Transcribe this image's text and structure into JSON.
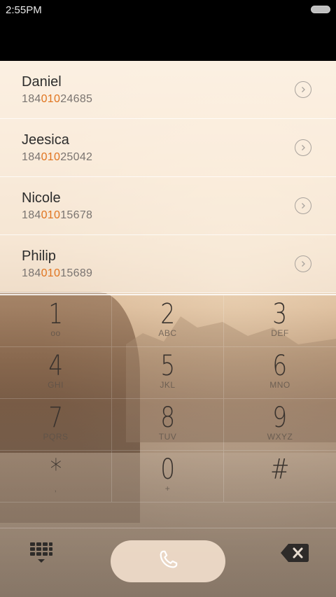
{
  "status_bar": {
    "time": "2:55PM"
  },
  "contacts": [
    {
      "name": "Daniel",
      "number_pre": "184",
      "number_match": "010",
      "number_post": "24685"
    },
    {
      "name": "Jeesica",
      "number_pre": "184",
      "number_match": "010",
      "number_post": "25042"
    },
    {
      "name": "Nicole",
      "number_pre": "184",
      "number_match": "010",
      "number_post": "15678"
    },
    {
      "name": "Philip",
      "number_pre": "184",
      "number_match": "010",
      "number_post": "15689"
    }
  ],
  "keypad": [
    {
      "digit": "1",
      "letters": "oo"
    },
    {
      "digit": "2",
      "letters": "ABC"
    },
    {
      "digit": "3",
      "letters": "DEF"
    },
    {
      "digit": "4",
      "letters": "GHI"
    },
    {
      "digit": "5",
      "letters": "JKL"
    },
    {
      "digit": "6",
      "letters": "MNO"
    },
    {
      "digit": "7",
      "letters": "PQRS"
    },
    {
      "digit": "8",
      "letters": "TUV"
    },
    {
      "digit": "9",
      "letters": "WXYZ"
    },
    {
      "digit": "*",
      "letters": ","
    },
    {
      "digit": "0",
      "letters": "+"
    },
    {
      "digit": "#",
      "letters": ""
    }
  ],
  "icons": {
    "battery": "battery-icon",
    "detail": "chevron-right-circle-icon",
    "dialpad": "dialpad-grid-icon",
    "call": "phone-handset-icon",
    "delete": "backspace-icon"
  },
  "colors": {
    "match_highlight": "#e0741f",
    "call_button": "#f6e2d0"
  }
}
